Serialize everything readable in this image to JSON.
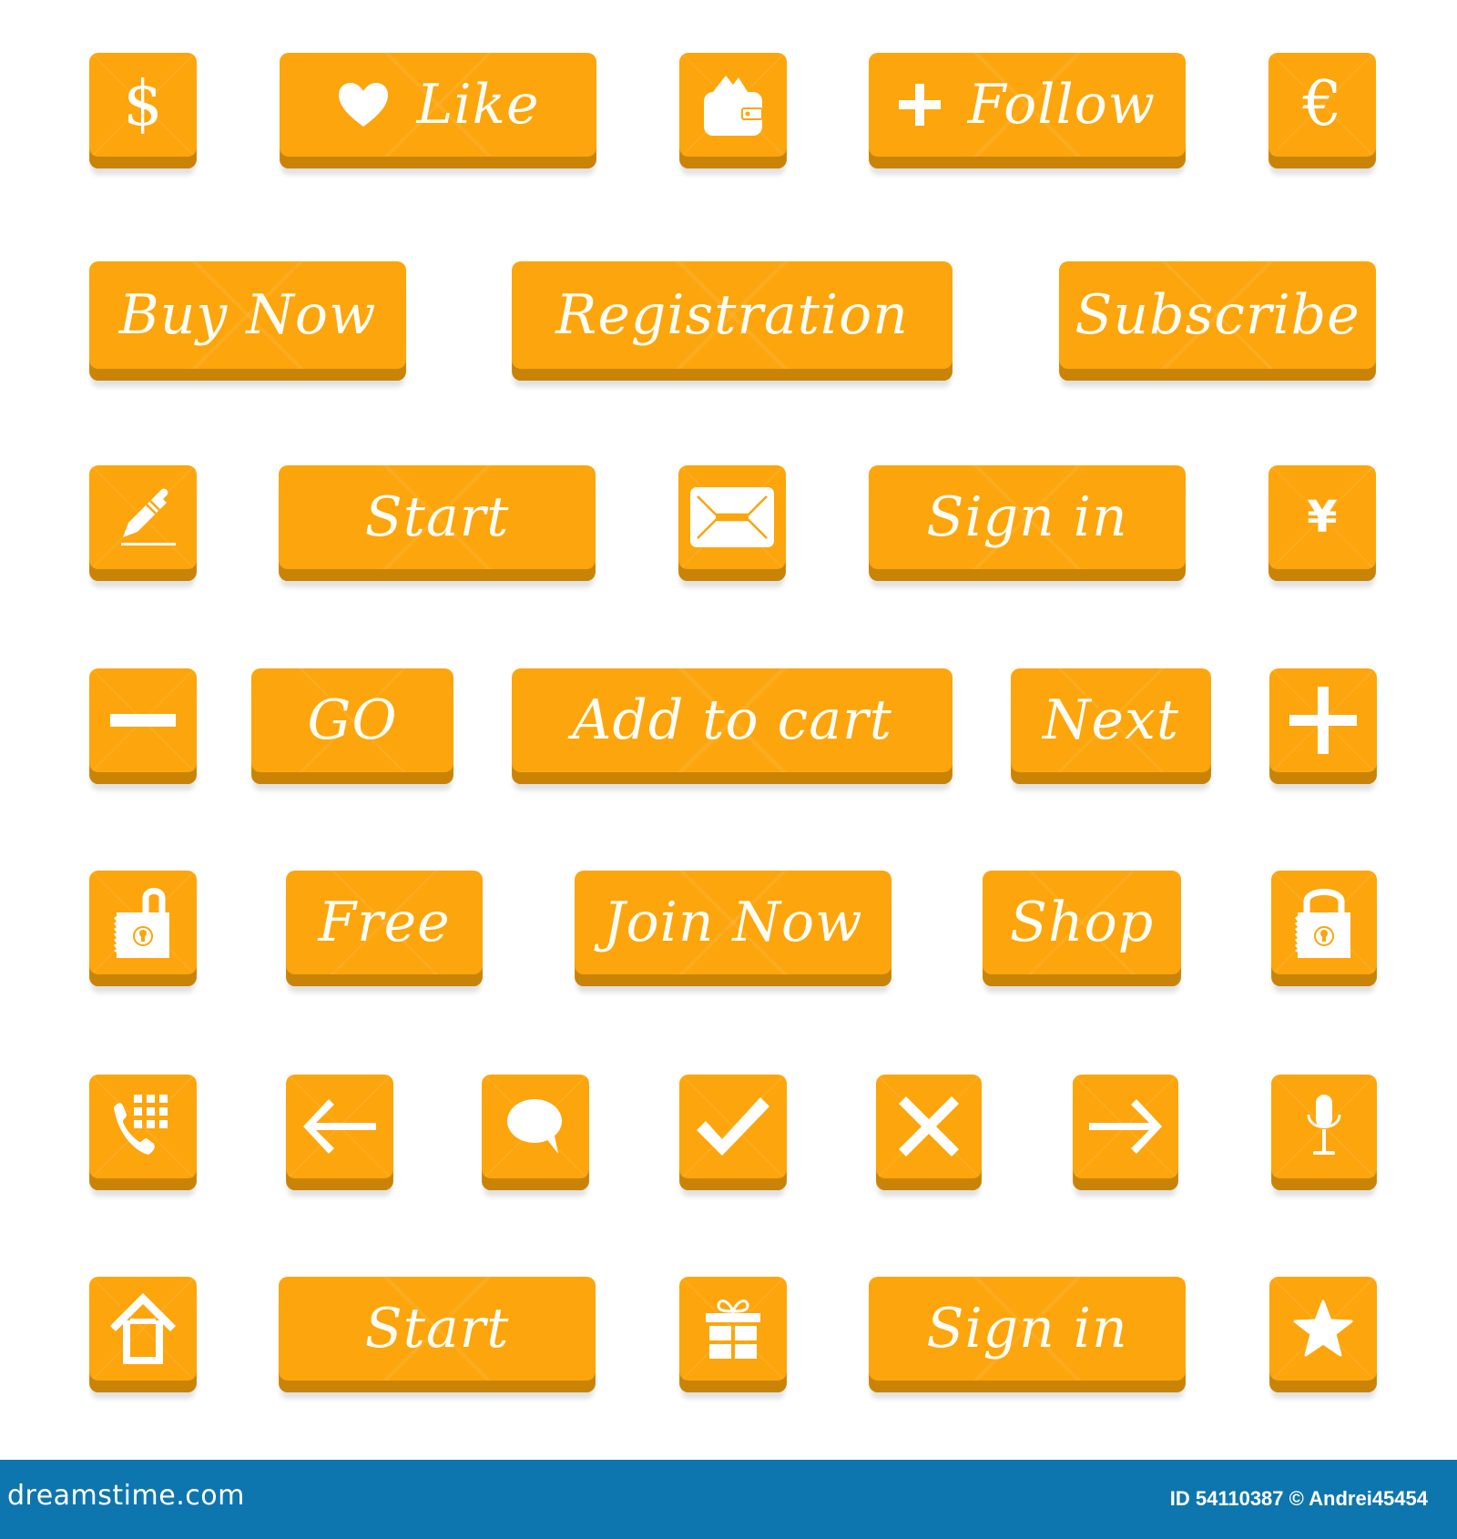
{
  "theme": {
    "button_color": "#fca50c",
    "button_edge": "#c98407",
    "footer_color": "#0e76ae",
    "text_color": "#ffffff"
  },
  "rows": [
    {
      "items": [
        {
          "type": "icon",
          "icon": "dollar-icon",
          "glyph": "$"
        },
        {
          "type": "text",
          "icon": "heart-icon",
          "label": "Like"
        },
        {
          "type": "icon",
          "icon": "wallet-icon"
        },
        {
          "type": "text",
          "icon": "plus-icon",
          "label": "Follow"
        },
        {
          "type": "icon",
          "icon": "euro-icon",
          "glyph": "€"
        }
      ]
    },
    {
      "items": [
        {
          "type": "text",
          "label": "Buy Now"
        },
        {
          "type": "text",
          "label": "Registration"
        },
        {
          "type": "text",
          "label": "Subscribe"
        }
      ]
    },
    {
      "items": [
        {
          "type": "icon",
          "icon": "pencil-icon"
        },
        {
          "type": "text",
          "label": "Start"
        },
        {
          "type": "icon",
          "icon": "envelope-icon"
        },
        {
          "type": "text",
          "label": "Sign in"
        },
        {
          "type": "icon",
          "icon": "yen-icon",
          "glyph": "¥"
        }
      ]
    },
    {
      "items": [
        {
          "type": "icon",
          "icon": "minus-icon"
        },
        {
          "type": "text",
          "label": "GO"
        },
        {
          "type": "text",
          "label": "Add to cart"
        },
        {
          "type": "text",
          "label": "Next"
        },
        {
          "type": "icon",
          "icon": "plus-icon"
        }
      ]
    },
    {
      "items": [
        {
          "type": "icon",
          "icon": "unlocked-padlock-icon"
        },
        {
          "type": "text",
          "label": "Free"
        },
        {
          "type": "text",
          "label": "Join Now"
        },
        {
          "type": "text",
          "label": "Shop"
        },
        {
          "type": "icon",
          "icon": "locked-padlock-icon"
        }
      ]
    },
    {
      "items": [
        {
          "type": "icon",
          "icon": "phone-keypad-icon"
        },
        {
          "type": "icon",
          "icon": "arrow-left-icon"
        },
        {
          "type": "icon",
          "icon": "speech-bubble-icon"
        },
        {
          "type": "icon",
          "icon": "checkmark-icon"
        },
        {
          "type": "icon",
          "icon": "close-icon"
        },
        {
          "type": "icon",
          "icon": "arrow-right-icon"
        },
        {
          "type": "icon",
          "icon": "microphone-icon"
        }
      ]
    },
    {
      "items": [
        {
          "type": "icon",
          "icon": "home-icon"
        },
        {
          "type": "text",
          "label": "Start"
        },
        {
          "type": "icon",
          "icon": "gift-icon"
        },
        {
          "type": "text",
          "label": "Sign in"
        },
        {
          "type": "icon",
          "icon": "star-icon"
        }
      ]
    }
  ],
  "footer": {
    "logo": "dreamstime.com",
    "credit": "ID 54110387 © Andrei45454"
  }
}
